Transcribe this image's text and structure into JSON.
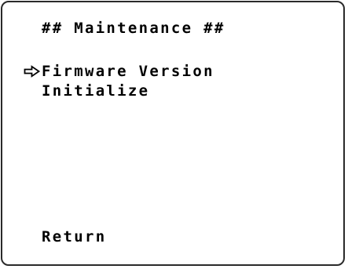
{
  "menu": {
    "title": "## Maintenance ##",
    "items": [
      {
        "label": "Firmware Version",
        "selected": true
      },
      {
        "label": "Initialize",
        "selected": false
      }
    ],
    "return_label": "Return",
    "cursor_icon": "hollow-arrow-right-icon"
  }
}
